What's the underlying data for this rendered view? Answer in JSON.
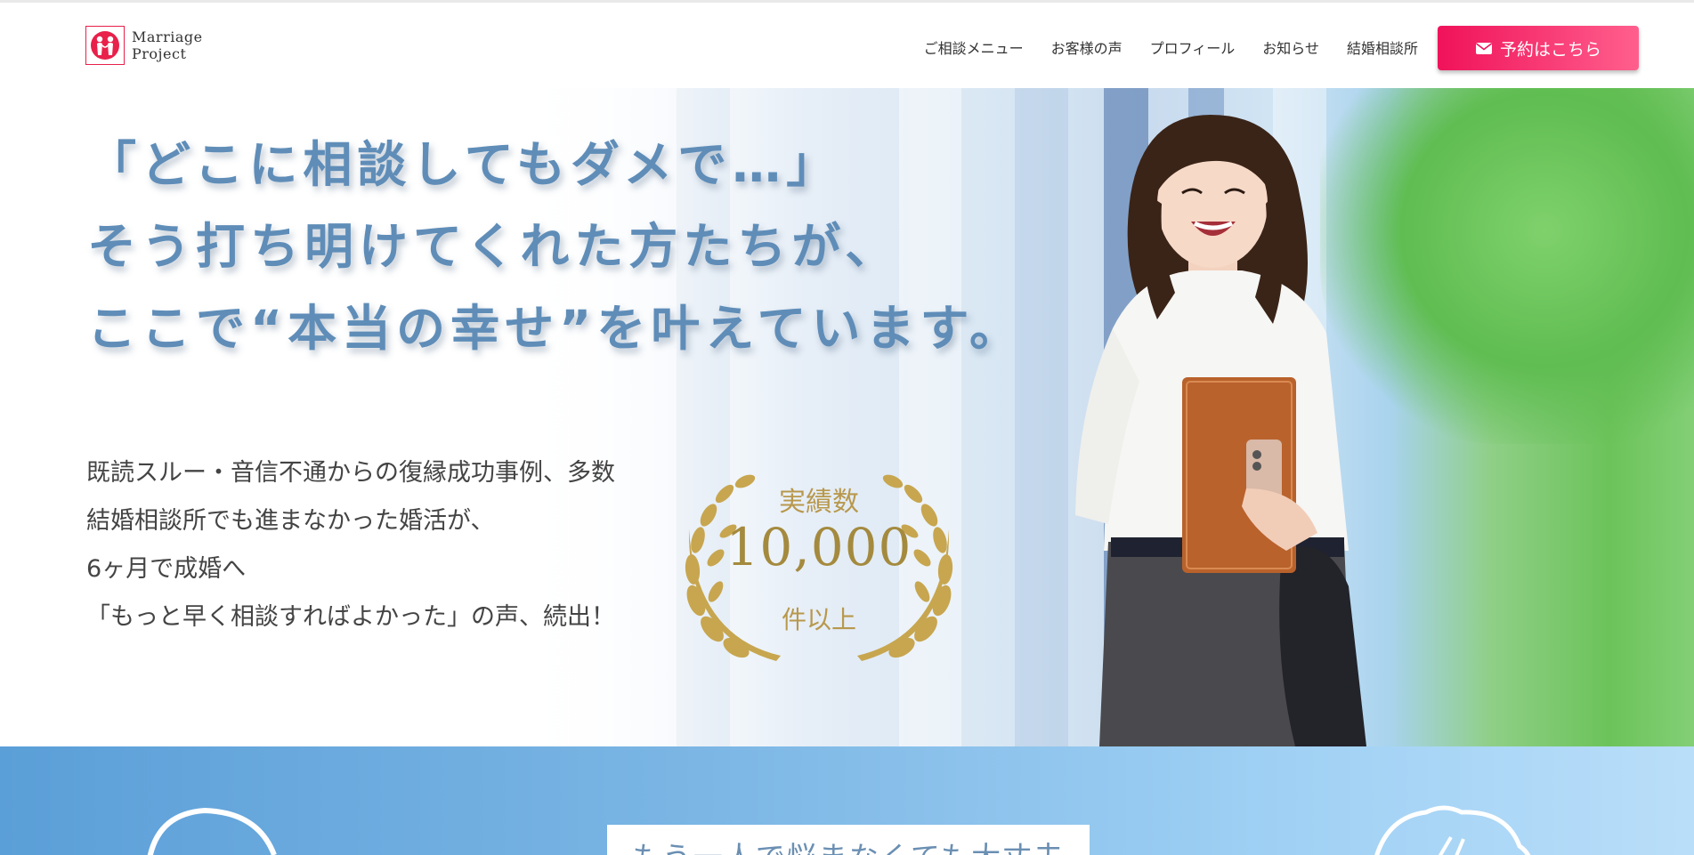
{
  "brand": {
    "name_line1": "Marriage",
    "name_line2": "Project",
    "accent": "#e8204a"
  },
  "nav": {
    "items": [
      {
        "label": "ご相談メニュー"
      },
      {
        "label": "お客様の声"
      },
      {
        "label": "プロフィール"
      },
      {
        "label": "お知らせ"
      },
      {
        "label": "結婚相談所"
      }
    ],
    "cta_label": "予約はこちら",
    "cta_icon": "envelope-icon"
  },
  "hero": {
    "headline": [
      "「どこに相談してもダメで…」",
      "そう打ち明けてくれた方たちが、",
      "ここで“本当の幸せ”を叶えています。"
    ],
    "subtext": [
      "既読スルー・音信不通からの復縁成功事例、多数",
      "結婚相談所でも進まなかった婚活が、",
      "6ヶ月で成婚へ",
      "「もっと早く相談すればよかった」の声、続出！"
    ],
    "badge": {
      "title": "実績数",
      "number": "10,000",
      "unit": "件以上",
      "icon": "laurel-wreath-icon"
    }
  },
  "section": {
    "title": "もう一人で悩まなくても大丈夫"
  },
  "colors": {
    "headline": "#5f8db8",
    "cta_start": "#f0125a",
    "cta_end": "#ff5f8d",
    "gold": "#a48a3e",
    "band_start": "#5b9fd8",
    "band_end": "#b9def9"
  }
}
